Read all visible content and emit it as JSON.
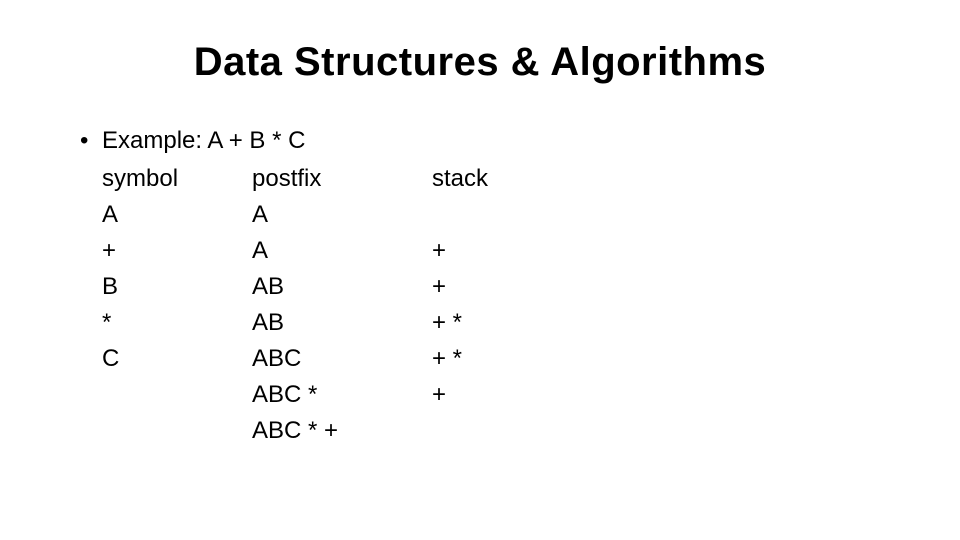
{
  "title": "Data Structures & Algorithms",
  "bullet": "Example: A + B * C",
  "headers": {
    "symbol": "symbol",
    "postfix": "postfix",
    "stack": "stack"
  },
  "rows": [
    {
      "symbol": "A",
      "postfix": "A",
      "stack": ""
    },
    {
      "symbol": "+",
      "postfix": "A",
      "stack": "+"
    },
    {
      "symbol": "B",
      "postfix": "AB",
      "stack": "+"
    },
    {
      "symbol": "*",
      "postfix": "AB",
      "stack": "+ *"
    },
    {
      "symbol": "C",
      "postfix": "ABC",
      "stack": "+ *"
    },
    {
      "symbol": "",
      "postfix": "ABC *",
      "stack": "+"
    },
    {
      "symbol": "",
      "postfix": "ABC * +",
      "stack": ""
    }
  ]
}
